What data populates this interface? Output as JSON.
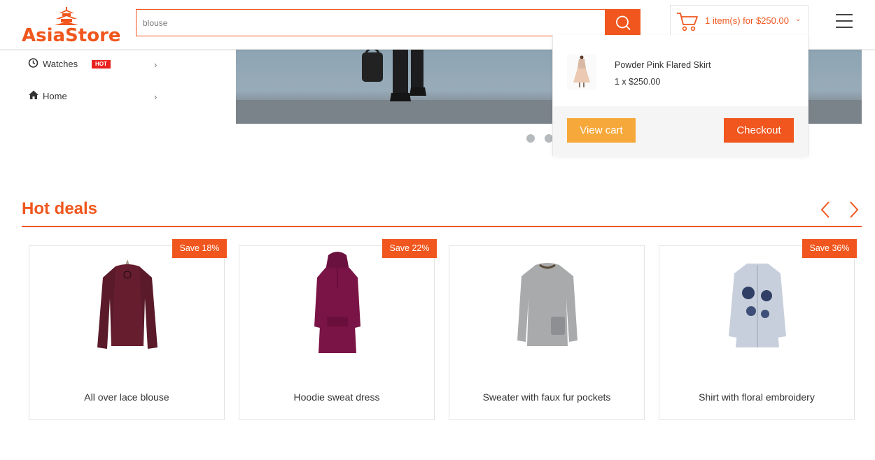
{
  "brand": {
    "name": "AsiaStore",
    "color": "#f0561d"
  },
  "search": {
    "value": "blouse",
    "icon": "search-icon"
  },
  "cart": {
    "summary": "1 item(s) for $250.00",
    "icon": "cart-icon"
  },
  "menu": {
    "icon": "hamburger-icon"
  },
  "sidebar": {
    "items": [
      {
        "label": "Watches",
        "icon": "clock-icon",
        "badge": "HOT"
      },
      {
        "label": "Home",
        "icon": "home-icon"
      }
    ]
  },
  "banner": {
    "slides": 2,
    "active_slide": 1
  },
  "cart_dropdown": {
    "item_name": "Powder Pink Flared Skirt",
    "item_qty_price": "1 x $250.00",
    "view_cart_label": "View cart",
    "checkout_label": "Checkout"
  },
  "hot_deals": {
    "title": "Hot deals",
    "products": [
      {
        "name": "All over lace blouse",
        "badge": "Save 18%",
        "color": "#5a1a2a"
      },
      {
        "name": "Hoodie sweat dress",
        "badge": "Save 22%",
        "color": "#7a1446"
      },
      {
        "name": "Sweater with faux fur pockets",
        "badge": "",
        "color": "#a9aaac"
      },
      {
        "name": "Shirt with floral embroidery",
        "badge": "Save 36%",
        "color": "#c8cfdc"
      }
    ]
  }
}
